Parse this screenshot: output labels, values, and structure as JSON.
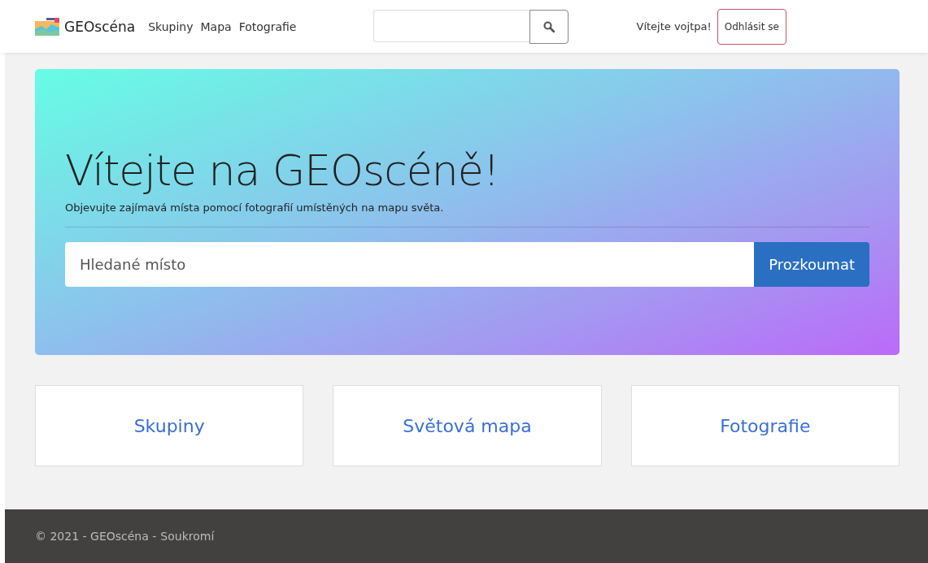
{
  "navbar": {
    "brand": "GEOscéna",
    "links": [
      "Skupiny",
      "Mapa",
      "Fotografie"
    ],
    "greeting": "Vítejte vojtpa!",
    "logout": "Odhlásit se"
  },
  "hero": {
    "title": "Vítejte na GEOscéně!",
    "subtitle": "Objevujte zajímavá místa pomocí fotografií umístěných na mapu světa.",
    "search": {
      "placeholder": "Hledané místo"
    },
    "button": "Prozkoumat"
  },
  "cards": [
    "Skupiny",
    "Světová mapa",
    "Fotografie"
  ],
  "footer": {
    "text": "© 2021 - GEOscéna -",
    "link": "Soukromí"
  }
}
